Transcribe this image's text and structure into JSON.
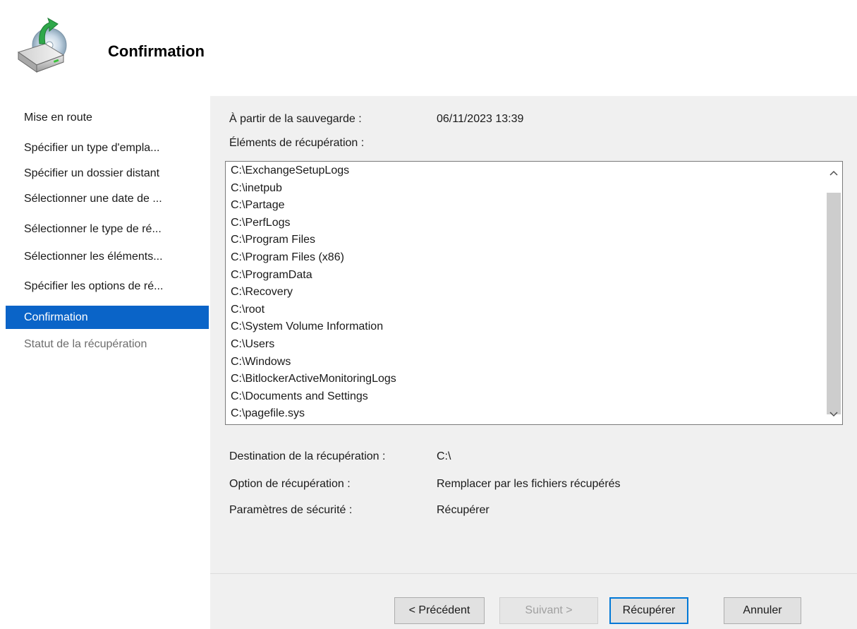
{
  "header": {
    "title": "Confirmation",
    "icon": "backup-restore-drive-icon"
  },
  "sidebar": {
    "items": [
      {
        "label": "Mise en route",
        "state": "normal"
      },
      {
        "label": "Spécifier un type d'empla...",
        "state": "normal"
      },
      {
        "label": "Spécifier un dossier distant",
        "state": "normal"
      },
      {
        "label": "Sélectionner une date de ...",
        "state": "normal"
      },
      {
        "label": "Sélectionner le type de ré...",
        "state": "normal"
      },
      {
        "label": "Sélectionner les éléments...",
        "state": "normal"
      },
      {
        "label": "Spécifier les options de ré...",
        "state": "normal"
      },
      {
        "label": "Confirmation",
        "state": "active"
      },
      {
        "label": "Statut de la récupération",
        "state": "disabled"
      }
    ]
  },
  "main": {
    "backup_label": "À partir de la sauvegarde :",
    "backup_value": "06/11/2023 13:39",
    "items_label": "Éléments de récupération :",
    "items": [
      "C:\\ExchangeSetupLogs",
      "C:\\inetpub",
      "C:\\Partage",
      "C:\\PerfLogs",
      "C:\\Program Files",
      "C:\\Program Files (x86)",
      "C:\\ProgramData",
      "C:\\Recovery",
      "C:\\root",
      "C:\\System Volume Information",
      "C:\\Users",
      "C:\\Windows",
      "C:\\BitlockerActiveMonitoringLogs",
      "C:\\Documents and Settings",
      "C:\\pagefile.sys"
    ],
    "destination_label": "Destination de la récupération :",
    "destination_value": "C:\\",
    "option_label": "Option de récupération :",
    "option_value": "Remplacer par les fichiers récupérés",
    "security_label": "Paramètres de sécurité :",
    "security_value": "Récupérer"
  },
  "footer": {
    "previous_label": "< Précédent",
    "next_label": "Suivant >",
    "recover_label": "Récupérer",
    "cancel_label": "Annuler"
  },
  "colors": {
    "accent": "#0a64c8",
    "panel": "#f0f0f0"
  }
}
